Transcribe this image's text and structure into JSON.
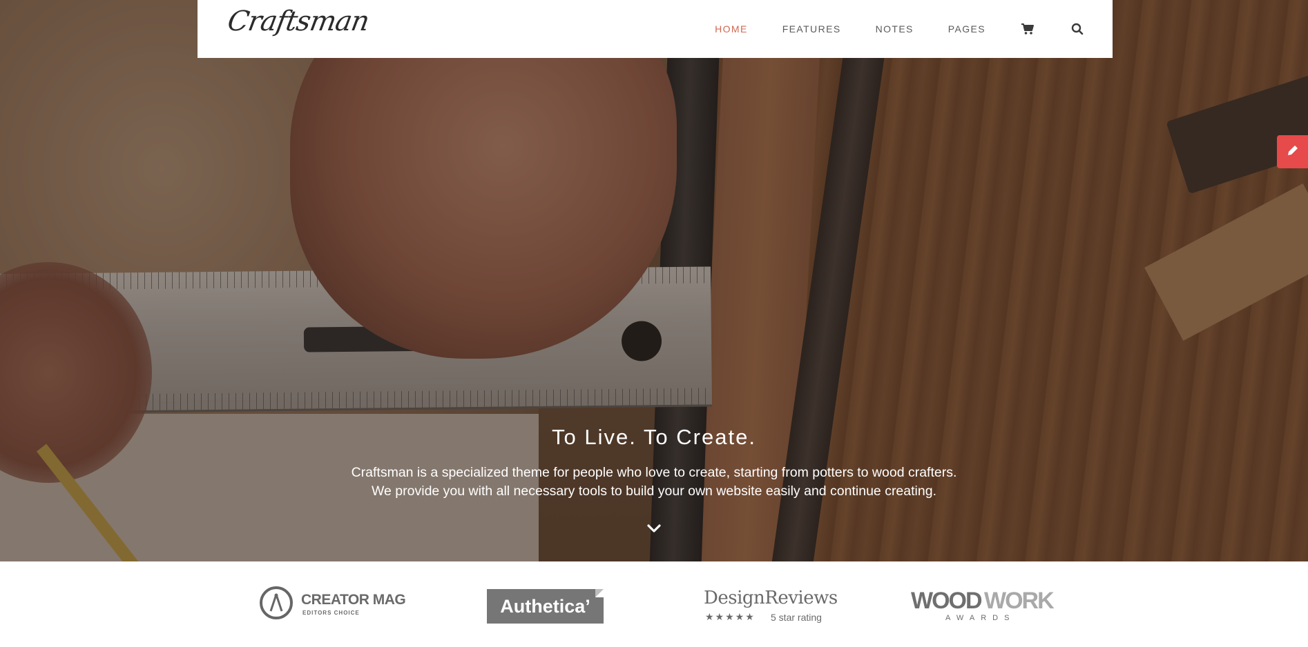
{
  "brand": {
    "logo_text": "Craftsman"
  },
  "nav": {
    "items": [
      {
        "label": "HOME",
        "active": true
      },
      {
        "label": "FEATURES",
        "active": false
      },
      {
        "label": "NOTES",
        "active": false
      },
      {
        "label": "PAGES",
        "active": false
      }
    ],
    "icons": [
      "shopping-cart-icon",
      "search-icon"
    ]
  },
  "hero": {
    "title": "To Live. To Create.",
    "subtitle_line1": "Craftsman is a specialized theme for people who love to create, starting from potters to wood crafters.",
    "subtitle_line2": "We provide you with all necessary tools to build your own website easily and continue creating."
  },
  "side_button": {
    "icon": "pencil-icon"
  },
  "badges": {
    "creator": {
      "name": "CREATOR MAG",
      "sub": "EDITORS CHOICE"
    },
    "authetica": {
      "name": "Authetica’"
    },
    "design": {
      "name": "DesignReviews",
      "stars": "★★★★★",
      "rating": "5 star rating"
    },
    "woodwork": {
      "wood": "WOOD",
      "work": "WORK",
      "awards": "AWARDS"
    }
  },
  "colors": {
    "accent": "#d0684f",
    "side_button": "#e64a4a",
    "badge_gray": "#767676"
  }
}
